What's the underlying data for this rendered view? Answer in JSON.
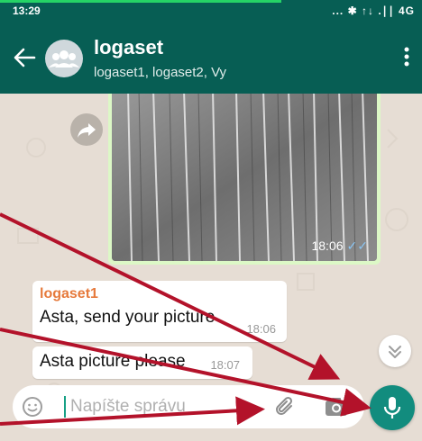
{
  "status_bar": {
    "time": "13:29",
    "network": "... ✱ ↑↓ .∣∣ 4G"
  },
  "header": {
    "title": "logaset",
    "subtitle": "logaset1, logaset2, Vy"
  },
  "messages": [
    {
      "sender": "logaset1",
      "text": "Asta, send your picture",
      "time": "18:06"
    },
    {
      "text": "Asta picture please",
      "time": "18:07"
    }
  ],
  "image_message": {
    "time": "18:06",
    "ticks": "✓✓"
  },
  "composer": {
    "placeholder": "Napíšte správu"
  },
  "icons": {
    "back": "back-arrow-icon",
    "menu": "vertical-dots-icon",
    "share": "forward-share-icon",
    "emoji": "emoji-icon",
    "attach": "paperclip-icon",
    "camera": "camera-icon",
    "mic": "microphone-icon",
    "scroll": "double-chevron-down-icon"
  },
  "colors": {
    "app_bar": "#075e54",
    "accent": "#128c7e",
    "outgoing_bubble": "#dcf8c6",
    "incoming_bubble": "#ffffff",
    "sender_name": "#e67a3c",
    "annotation_arrow": "#b3122a"
  }
}
